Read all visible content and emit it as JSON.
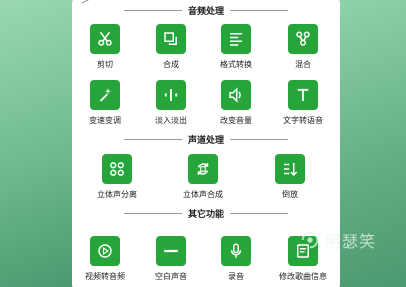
{
  "sections": {
    "audio": {
      "title": "音频处理"
    },
    "channel": {
      "title": "声道处理"
    },
    "other": {
      "title": "其它功能"
    }
  },
  "tools": {
    "cut": "剪切",
    "merge": "合成",
    "format_convert": "格式转换",
    "mix": "混合",
    "speed_pitch": "变速变调",
    "fade": "淡入淡出",
    "volume": "改变音量",
    "tts": "文字转语音",
    "stereo_split": "立体声分离",
    "stereo_merge": "立体声合成",
    "reverse": "倒放",
    "video_to_audio": "视频转音频",
    "silence": "空白声音",
    "record": "录音",
    "edit_tags": "修改歌曲信息"
  },
  "watermark": {
    "text": "明瑟笑"
  },
  "colors": {
    "accent": "#26a53a",
    "background": "#66b488"
  }
}
